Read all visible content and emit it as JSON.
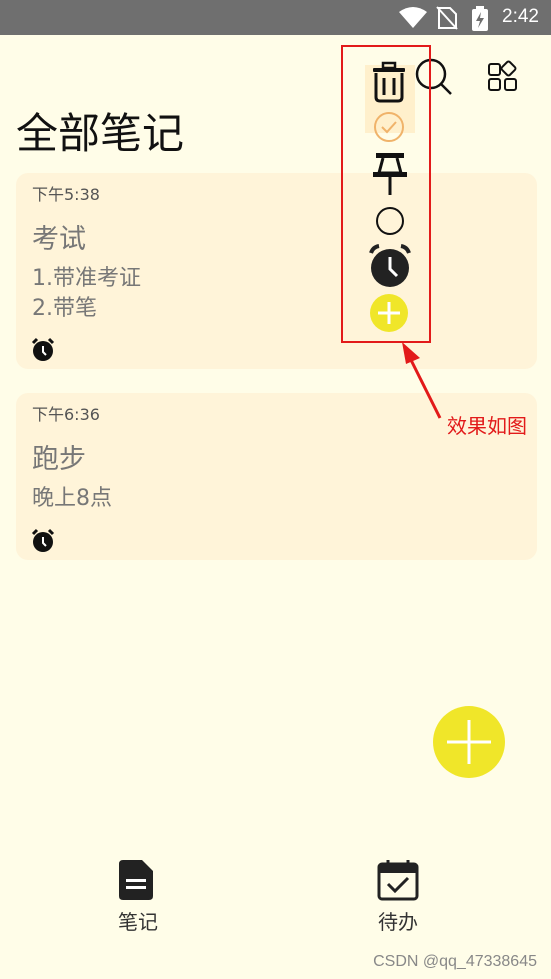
{
  "status_bar": {
    "time": "2:42"
  },
  "page": {
    "title": "全部笔记"
  },
  "notes": [
    {
      "time": "下午5:38",
      "title": "考试",
      "lines": [
        "1.带准考证",
        "2.带笔"
      ]
    },
    {
      "time": "下午6:36",
      "title": "跑步",
      "lines": [
        "晚上8点"
      ]
    }
  ],
  "annotation": {
    "text": "效果如图"
  },
  "nav": {
    "notes_label": "笔记",
    "todo_label": "待办"
  },
  "watermark": "CSDN @qq_47338645",
  "colors": {
    "background": "#fffde8",
    "card": "#fff4d9",
    "accent": "#f0e629",
    "annotation": "#e21a1a",
    "check": "#f0b36a"
  }
}
